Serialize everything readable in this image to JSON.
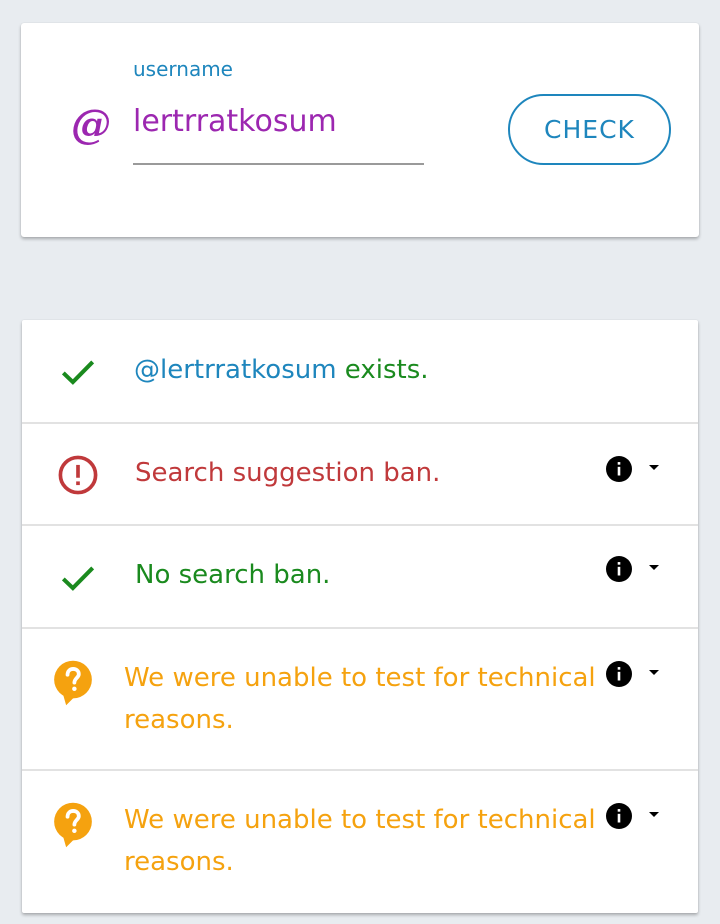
{
  "search": {
    "label": "username",
    "value": "lertrratkosum",
    "check_label": "CHECK",
    "at_symbol": "@"
  },
  "results": {
    "exists": {
      "handle": "@lertrratkosum",
      "suffix": " exists.",
      "icon": "check-icon",
      "status": "ok"
    },
    "suggestion_ban": {
      "text": "Search suggestion ban.",
      "icon": "alert-circle-icon",
      "status": "ban"
    },
    "search_ban": {
      "text": "No search ban.",
      "icon": "check-icon",
      "status": "ok"
    },
    "test_one": {
      "line1": "We were unable to test for technical",
      "line2": "reasons.",
      "icon": "help-bubble-icon",
      "status": "unknown"
    },
    "test_two": {
      "line1": "We were unable to test for technical",
      "line2": "reasons.",
      "icon": "help-bubble-icon",
      "status": "unknown"
    }
  },
  "colors": {
    "accent": "#1e86bd",
    "username": "#9c27b0",
    "ok": "#1a8a1e",
    "ban": "#c0393b",
    "unknown": "#f5a20f",
    "background": "#e8ecf0"
  }
}
